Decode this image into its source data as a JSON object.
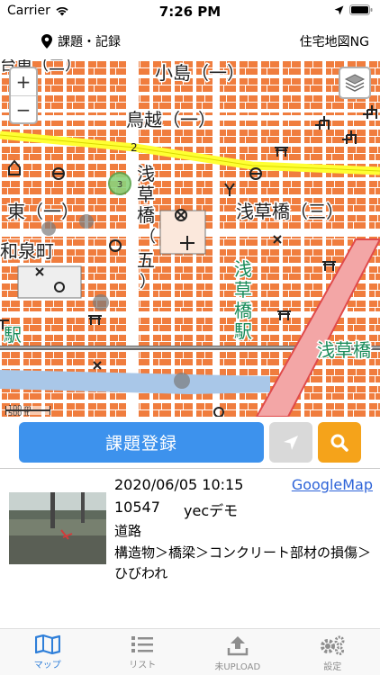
{
  "status_bar": {
    "carrier": "Carrier",
    "time": "7:26 PM",
    "wifi_icon": "wifi-icon",
    "location_icon": "location-arrow-icon",
    "battery_icon": "battery-icon"
  },
  "nav": {
    "location_label": "課題・記録",
    "right_label": "住宅地図NG",
    "pin_icon": "map-pin-icon"
  },
  "map": {
    "zoom_in": "+",
    "zoom_out": "−",
    "scale_m": "100 m",
    "scale_ft": "500 ft",
    "labels": {
      "kojima": "小島（一）",
      "torigoe": "鳥越（一）",
      "asakusabashi_3": "浅草橋（三）",
      "asakusabashi_5_a": "浅",
      "asakusabashi_5_b": "草",
      "asakusabashi_5_c": "橋",
      "asakusabashi_5_d": "（",
      "asakusabashi_5_e": "五",
      "asakusabashi_5_f": "）",
      "higashi": "東（一）",
      "izumicho": "和泉町",
      "station_a": "浅",
      "station_b": "草",
      "station_c": "橋",
      "station_d": "駅",
      "station2": "浅草橋",
      "eki_left": "駅",
      "top_left": "台東（二）",
      "route_num": "2",
      "cluster": "3"
    },
    "colors": {
      "block": "#f07d3e",
      "street": "#ffffff",
      "background": "#f2dfd0",
      "highway": "#ffff33",
      "river": "#a9c7e8",
      "railway": "#666666",
      "station_text": "#1a8c5a"
    }
  },
  "actions": {
    "register_label": "課題登録",
    "locate_icon": "navigation-arrow-icon",
    "search_icon": "search-icon"
  },
  "record": {
    "datetime": "2020/06/05 10:15",
    "link": "GoogleMap",
    "id": "10547",
    "user": "yecデモ",
    "category": "道路",
    "description": "構造物＞橋梁＞コンクリート部材の損傷＞ひびわれ"
  },
  "tabs": [
    {
      "label": "マップ",
      "icon": "map-icon",
      "active": true
    },
    {
      "label": "リスト",
      "icon": "list-icon",
      "active": false
    },
    {
      "label": "未UPLOAD",
      "icon": "upload-icon",
      "active": false
    },
    {
      "label": "設定",
      "icon": "gears-icon",
      "active": false
    }
  ]
}
